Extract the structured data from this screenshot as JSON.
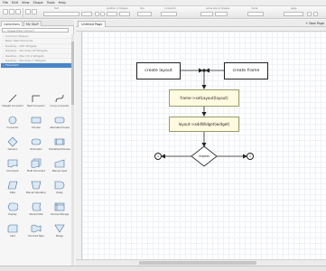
{
  "menu": [
    "File",
    "Edit",
    "View",
    "Shape",
    "Tools",
    "Help"
  ],
  "toolbar": {
    "labels": [
      "font",
      "position of shapes",
      "line",
      "connector",
      "same size of shapes",
      "mode",
      "page"
    ]
  },
  "left_panel": {
    "tabs": [
      "Collections",
      "My Stuff"
    ],
    "search_placeholder": "Shape filter (Ctrl+F)",
    "libraries": [
      "Common Shapes",
      "Basic Web Elements",
      "Desktop - GTK Widgets",
      "Desktop - Windows XP Widgets",
      "Desktop - Mac OS X Widgets",
      "Desktop - Windows 7 Widgets",
      "Flowchart"
    ],
    "selected_library": "Flowchart",
    "shapes": [
      "Straight Connector",
      "Bent Connector",
      "Curvy Connector",
      "Connector",
      "Process",
      "Alternate Process",
      "Decision",
      "Terminator",
      "Predefined Process",
      "Document",
      "Multi Document",
      "Manual Input",
      "Data",
      "Manual Operation",
      "Delay",
      "Display",
      "Stored Data",
      "Internal Storage",
      "Card",
      "Punched Tape",
      "Merge"
    ]
  },
  "document": {
    "tab_title": "Untitled Page",
    "new_page_label": "New Page"
  },
  "diagram": {
    "create_layout": "create layout",
    "create_frame": "create frame",
    "set_layout": "frame->setLayout(layout)",
    "add_widget": "layout->addWidget(widget)",
    "repeat": "repeat",
    "connector_left": "1",
    "connector_right": "1"
  },
  "colors": {
    "selected_library_bg": "#4a86c6",
    "process_fill": "#fffbe0",
    "canvas_grid": "#eef1f6"
  }
}
